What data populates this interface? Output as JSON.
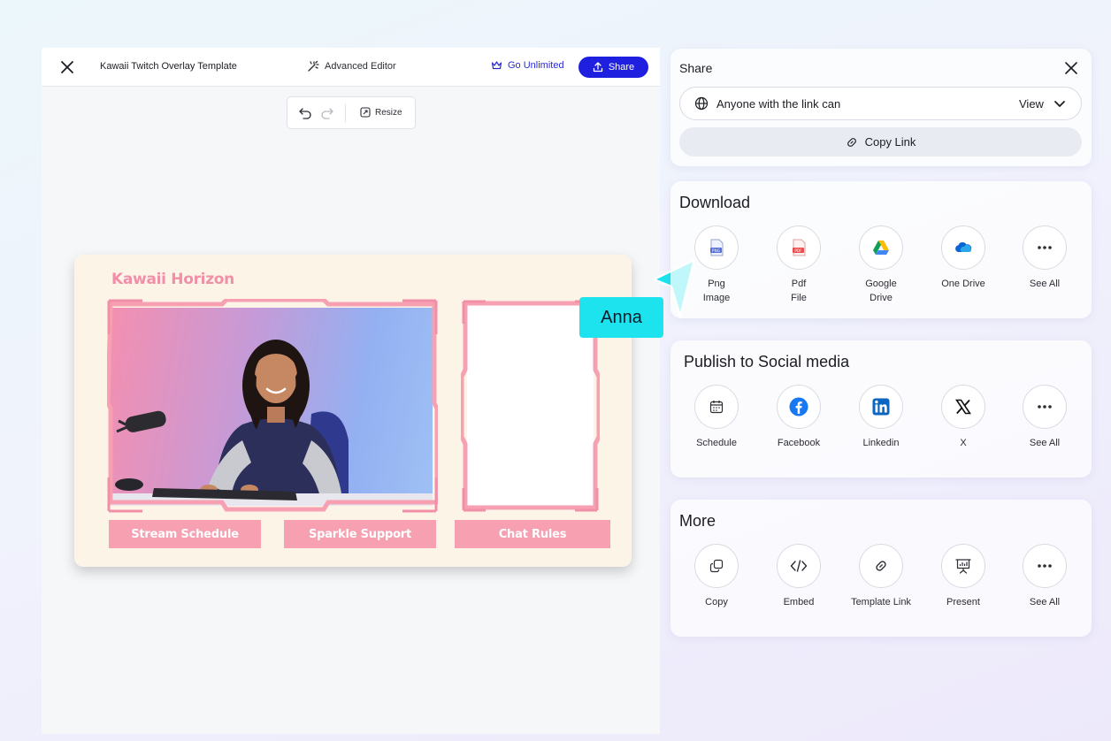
{
  "editor": {
    "doc_title": "Kawaii Twitch Overlay Template",
    "advanced_editor": "Advanced Editor",
    "go_unlimited": "Go Unlimited",
    "share": "Share",
    "resize": "Resize"
  },
  "canvas": {
    "brand": "Kawaii Horizon",
    "pills": [
      "Stream Schedule",
      "Sparkle Support",
      "Chat Rules"
    ]
  },
  "collab": {
    "name": "Anna",
    "color": "#1de3ee"
  },
  "share_panel": {
    "title": "Share",
    "permission_text": "Anyone with the link can",
    "permission_value": "View",
    "copy_link": "Copy Link"
  },
  "download": {
    "title": "Download",
    "items": [
      {
        "line1": "Png",
        "line2": "Image",
        "icon": "png-file-icon"
      },
      {
        "line1": "Pdf",
        "line2": "File",
        "icon": "pdf-file-icon"
      },
      {
        "line1": "Google",
        "line2": "Drive",
        "icon": "google-drive-icon"
      },
      {
        "line1": "One Drive",
        "line2": "",
        "icon": "onedrive-icon"
      },
      {
        "line1": "See All",
        "line2": "",
        "icon": "more-dots-icon"
      }
    ]
  },
  "social": {
    "title": "Publish to Social media",
    "items": [
      {
        "label": "Schedule",
        "icon": "calendar-icon"
      },
      {
        "label": "Facebook",
        "icon": "facebook-icon"
      },
      {
        "label": "Linkedin",
        "icon": "linkedin-icon"
      },
      {
        "label": "X",
        "icon": "x-icon"
      },
      {
        "label": "See All",
        "icon": "more-dots-icon"
      }
    ]
  },
  "more": {
    "title": "More",
    "items": [
      {
        "label": "Copy",
        "icon": "copy-icon"
      },
      {
        "label": "Embed",
        "icon": "code-icon"
      },
      {
        "label": "Template Link",
        "icon": "link-icon"
      },
      {
        "label": "Present",
        "icon": "presentation-icon"
      },
      {
        "label": "See All",
        "icon": "more-dots-icon"
      }
    ]
  },
  "colors": {
    "accent": "#1f1fe0",
    "brand_pink": "#f28fa8",
    "canvas_bg": "#fdf4e8"
  }
}
